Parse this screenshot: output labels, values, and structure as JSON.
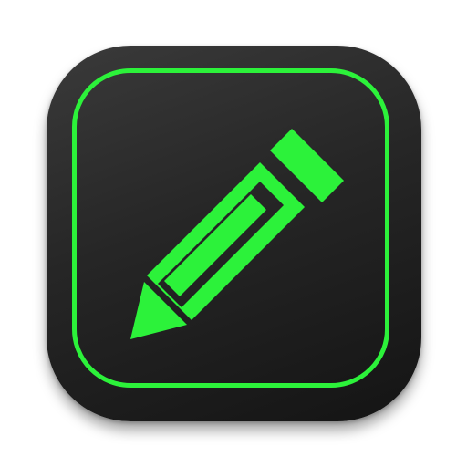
{
  "app_icon": {
    "icon_name": "pencil-icon",
    "colors": {
      "background_top": "#3a3a3a",
      "background_bottom": "#141414",
      "accent": "#2cf23a",
      "page_background": "#ffffff"
    }
  }
}
